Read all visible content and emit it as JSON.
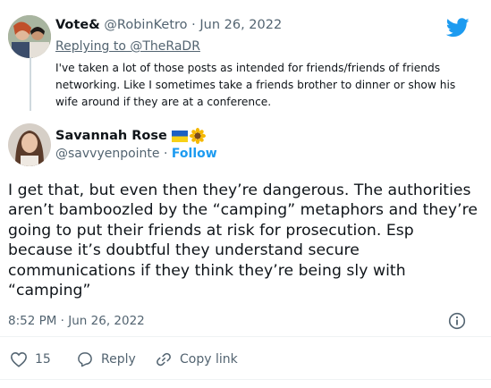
{
  "reply_tweet": {
    "display_name": "Vote&",
    "handle": "@RobinKetro",
    "dot": "·",
    "date": "Jun 26, 2022",
    "replying_to": "Replying to @TheRaDR",
    "text": "I've taken a lot of those posts as intended for friends/friends of friends networking. Like I sometimes take a friends brother to dinner or show his wife around if they are at a conference."
  },
  "main_tweet": {
    "display_name": "Savannah Rose",
    "emojis": "🇺🇦🌻",
    "handle": "@savvyenpointe",
    "dot": "·",
    "follow_label": "Follow",
    "text": "I get that, but even then they’re dangerous. The authorities aren’t bamboozled by the “camping” metaphors and they’re going to put their friends at risk for prosecution. Esp because it’s doubtful they understand secure communications if they think they’re being sly with “camping”",
    "timestamp": "8:52 PM · Jun 26, 2022"
  },
  "actions": {
    "like_count": "15",
    "reply_label": "Reply",
    "copy_link_label": "Copy link"
  },
  "colors": {
    "brand": "#1d9bf0",
    "muted": "#536471",
    "text": "#0f1419"
  },
  "icons": [
    "twitter-logo-icon",
    "info-icon",
    "heart-icon",
    "reply-icon",
    "link-icon",
    "flag-ua-icon",
    "sunflower-icon"
  ]
}
